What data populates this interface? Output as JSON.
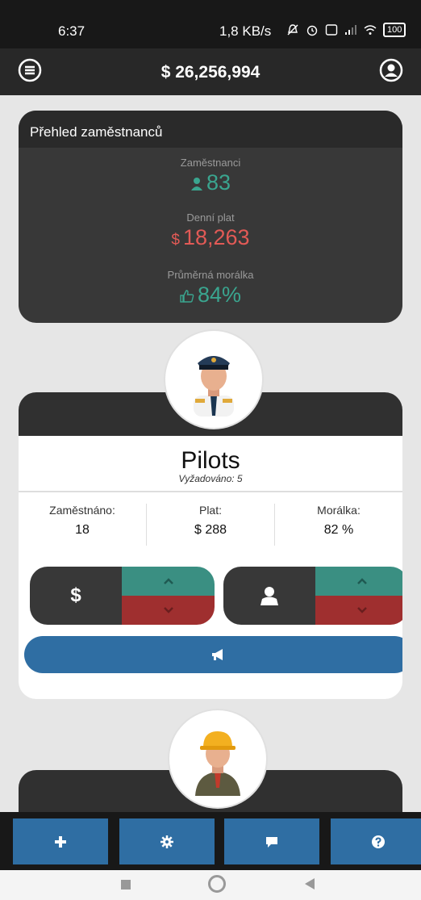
{
  "status_bar": {
    "time": "6:37",
    "network_speed": "1,8 KB/s",
    "battery": "100"
  },
  "header": {
    "balance": "$ 26,256,994",
    "menu_icon": "hamburger-menu-icon",
    "account_icon": "user-circle-icon"
  },
  "overview": {
    "title": "Přehled zaměstnanců",
    "employees": {
      "label": "Zaměstnanci",
      "value": "83"
    },
    "daily_pay": {
      "label": "Denní plat",
      "currency": "$",
      "value": "18,263"
    },
    "morale": {
      "label": "Průměrná morálka",
      "value": "84%"
    },
    "colors": {
      "green": "#3aa58f",
      "red": "#e25a56"
    }
  },
  "staff": {
    "title": "Pilots",
    "required": "Vyžadováno: 5",
    "employed": {
      "label": "Zaměstnáno:",
      "value": "18"
    },
    "salary": {
      "label": "Plat:",
      "value": "$ 288"
    },
    "morale": {
      "label": "Morálka:",
      "value": "82 %"
    },
    "salary_control_label": "$",
    "recruit_icon": "megaphone-icon",
    "colors": {
      "up": "#3a8f82",
      "down": "#9f2f2f",
      "recruit": "#2f6ea3"
    }
  },
  "bottom_nav": {
    "items": [
      {
        "icon": "plus-icon"
      },
      {
        "icon": "gear-icon"
      },
      {
        "icon": "chat-icon"
      },
      {
        "icon": "help-icon"
      }
    ]
  }
}
